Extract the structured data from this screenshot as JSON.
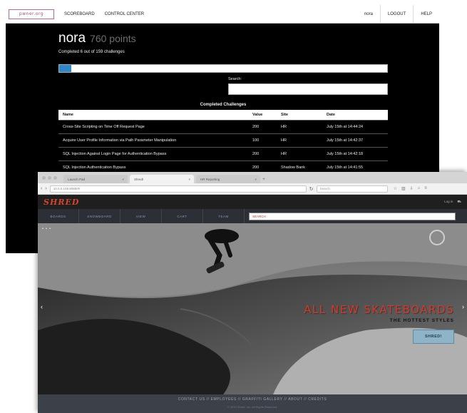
{
  "scoreboard": {
    "nav": {
      "logo": "pwner.org",
      "links": [
        "SCOREBOARD",
        "CONTROL CENTER"
      ],
      "user": "nora",
      "logout": "LOGOUT",
      "help": "HELP"
    },
    "username": "nora",
    "points": "760 points",
    "completed_text": "Completed 6 out of 159 challenges",
    "progress_fraction": 0.038,
    "search_label": "Search:",
    "search_value": "",
    "section_title": "Completed Challenges",
    "columns": [
      "Name",
      "Value",
      "Site",
      "Date"
    ],
    "rows": [
      [
        "Cross-Site Scripting on Time Off Request Page",
        "200",
        "HR",
        "July 15th at 14:44:24"
      ],
      [
        "Acquire User Profile Information via Path Parameter Manipulation",
        "100",
        "HR",
        "July 15th at 14:42:37"
      ],
      [
        "SQL Injection Against Login Page for Authentication Bypass",
        "200",
        "HR",
        "July 15th at 14:42:18"
      ],
      [
        "SQL Injection Authentication Bypass",
        "200",
        "Shadow Bank",
        "July 15th at 14:41:55"
      ]
    ]
  },
  "browser": {
    "tabs": [
      {
        "label": "Launch Pad",
        "active": false
      },
      {
        "label": "Shred!",
        "active": true
      },
      {
        "label": "HR Reporting",
        "active": false
      }
    ],
    "url": "10.0.0.105:8080/#/",
    "search_placeholder": "Search",
    "site": {
      "logo": "SHRED",
      "login": "Log in",
      "menu": [
        "BOARDS",
        "SNOWBOARD",
        "VIEW",
        "CART",
        "TEAM"
      ],
      "search_value": "SEARCH",
      "pager": "• • •",
      "hero_title": "ALL NEW SKATEBOARDS",
      "hero_subtitle": "THE HOTTEST STYLES",
      "hero_button": "SHRED!",
      "footer_links": "CONTACT US // EMPLOYEES // GRAFFITI GALLERY // ABOUT // CREDITS",
      "footer_copy": "© 2015 Shred, Inc. All Rights Reserved."
    }
  }
}
